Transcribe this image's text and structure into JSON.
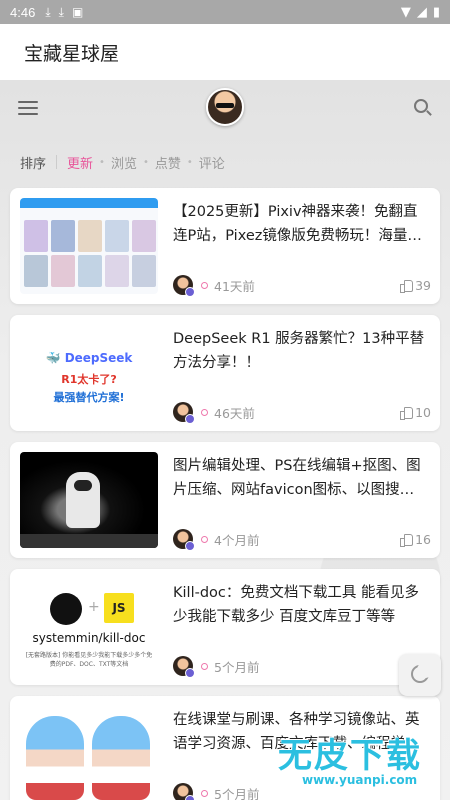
{
  "status_bar": {
    "time": "4:46",
    "icons": [
      "download-icon",
      "download-icon",
      "a-icon"
    ],
    "right_icons": [
      "wifi-icon",
      "signal-icon",
      "battery-icon"
    ]
  },
  "app": {
    "title": "宝藏星球屋"
  },
  "topnav": {
    "icons": [
      "menu-icon",
      "avatar",
      "search-icon"
    ]
  },
  "sort": {
    "label": "排序",
    "options": [
      {
        "label": "更新",
        "active": true
      },
      {
        "label": "浏览",
        "active": false
      },
      {
        "label": "点赞",
        "active": false
      },
      {
        "label": "评论",
        "active": false
      }
    ]
  },
  "posts": [
    {
      "title": "【2025更新】Pixiv神器来袭！免翻直连P站，Pixez镜像版免费畅玩！海量…",
      "time": "41天前",
      "likes": "39"
    },
    {
      "title": "DeepSeek R1 服务器繁忙？13种平替方法分享！！",
      "time": "46天前",
      "likes": "10",
      "thumb": {
        "brand": "DeepSeek",
        "line1": "R1太卡了?",
        "line2": "最强替代方案!"
      }
    },
    {
      "title": "图片编辑处理、PS在线编辑+抠图、图片压缩、网站favicon图标、以图搜…",
      "time": "4个月前",
      "likes": "16"
    },
    {
      "title": "Kill-doc：免费文档下载工具 能看见多少我能下载多少 百度文库豆丁等等",
      "time": "5个月前",
      "likes": "",
      "thumb": {
        "js": "JS",
        "repo": "systemmin/kill-doc",
        "caption": "[无套路版本] 你能看见多少我能下载多少多个免费的PDF、DOC、TXT等文档"
      }
    },
    {
      "title": "在线课堂与刷课、各种学习镜像站、英语学习资源、百度文库下载、编程学…",
      "time": "5个月前",
      "likes": ""
    }
  ],
  "watermark": {
    "text": "无皮下载",
    "url": "www.yuanpi.com"
  },
  "colors": {
    "accent": "#e8559a",
    "statusbar": "#a8a8a8"
  }
}
